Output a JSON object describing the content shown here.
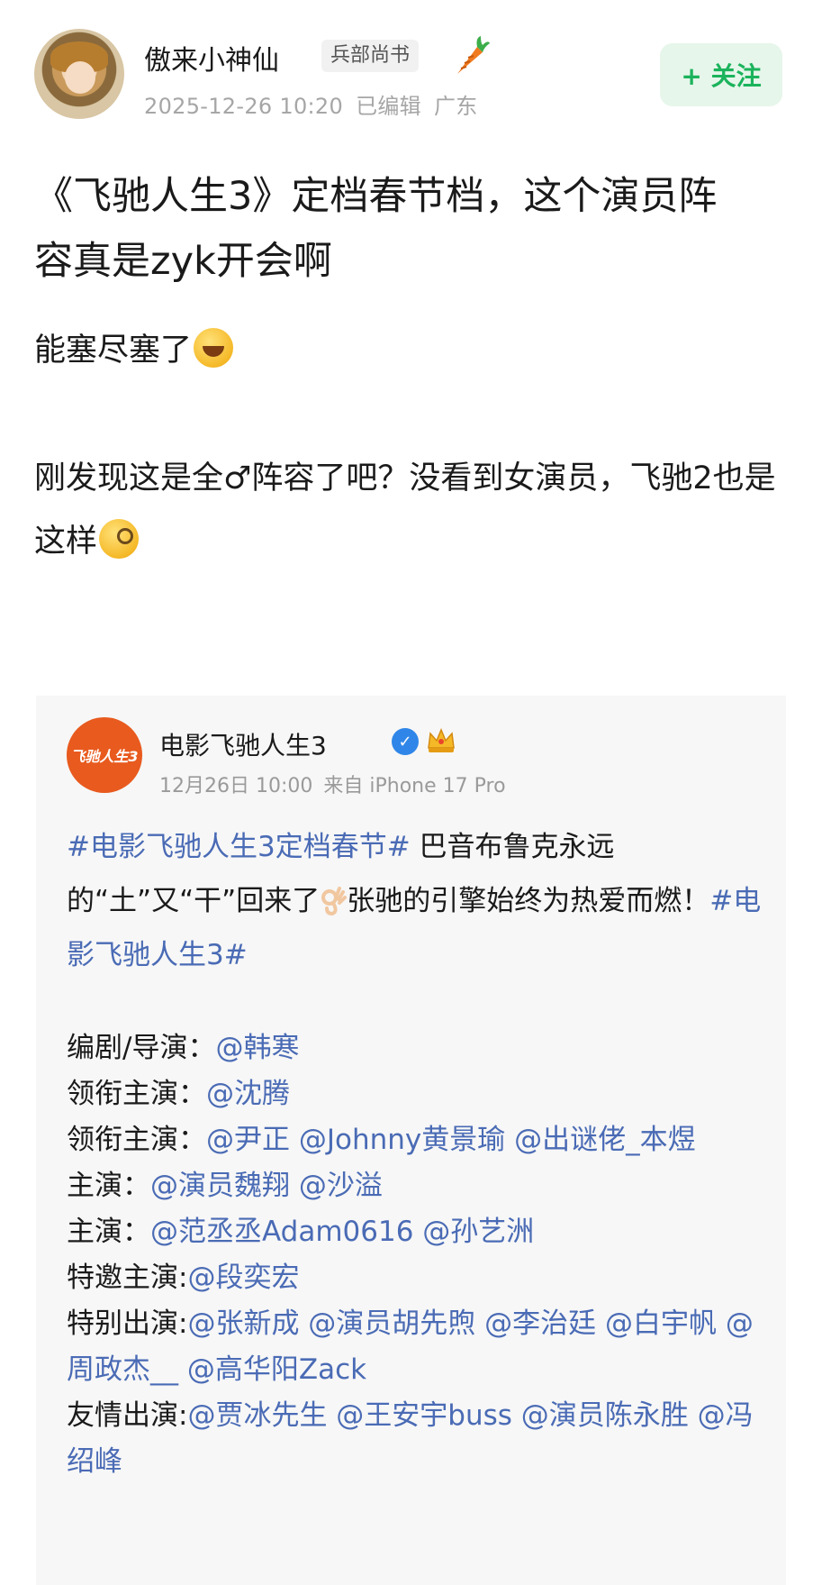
{
  "author": {
    "name": "傲来小神仙",
    "badge": "兵部尚书",
    "date": "2025-12-26 10:20",
    "edited": "已编辑",
    "location": "广东",
    "follow_label": "+ 关注"
  },
  "post": {
    "title": "《飞驰人生3》定档春节档，这个演员阵容真是zyk开会啊",
    "para1": "能塞尽塞了",
    "para2": "刚发现这是全♂阵容了吧？没看到女演员，飞驰2也是这样"
  },
  "repost": {
    "account_name": "电影飞驰人生3",
    "avatar_text": "飞驰人生3",
    "date": "12月26日 10:00",
    "source": "来自 iPhone 17 Pro",
    "hashtag1": "#电影飞驰人生3定档春节#",
    "body_text": " 巴音布鲁克永远的“土”又“干”回来了",
    "body_text2": "张驰的引擎始终为热爱而燃！",
    "hashtag2": "#电影飞驰人生3#",
    "credits": [
      {
        "role": "编剧/导演：",
        "names": "@韩寒"
      },
      {
        "role": "领衔主演：",
        "names": "@沈腾"
      },
      {
        "role": "领衔主演：",
        "names": "@尹正 @Johnny黄景瑜 @出谜佬_本煜"
      },
      {
        "role": "主演：",
        "names": "@演员魏翔 @沙溢"
      },
      {
        "role": "主演：",
        "names": "@范丞丞Adam0616 @孙艺洲"
      },
      {
        "role": "特邀主演:",
        "names": "@段奕宏"
      },
      {
        "role": "特别出演:",
        "names": "@张新成 @演员胡先煦 @李治廷 @白宇帆 @周政杰__ @高华阳Zack"
      },
      {
        "role": "友情出演:",
        "names": "@贾冰先生 @王安宇buss @演员陈永胜 @冯绍峰"
      }
    ]
  },
  "colors": {
    "link": "#4a6bb5",
    "follow_bg": "#e6f6ea",
    "follow_text": "#1bb35c",
    "meta_gray": "#a6a6a6",
    "repost_bg": "#f7f7f7"
  },
  "icons": [
    "carrot-icon",
    "laughing-emoji-icon",
    "monocle-emoji-icon",
    "verified-icon",
    "crown-icon",
    "ok-hand-icon"
  ]
}
